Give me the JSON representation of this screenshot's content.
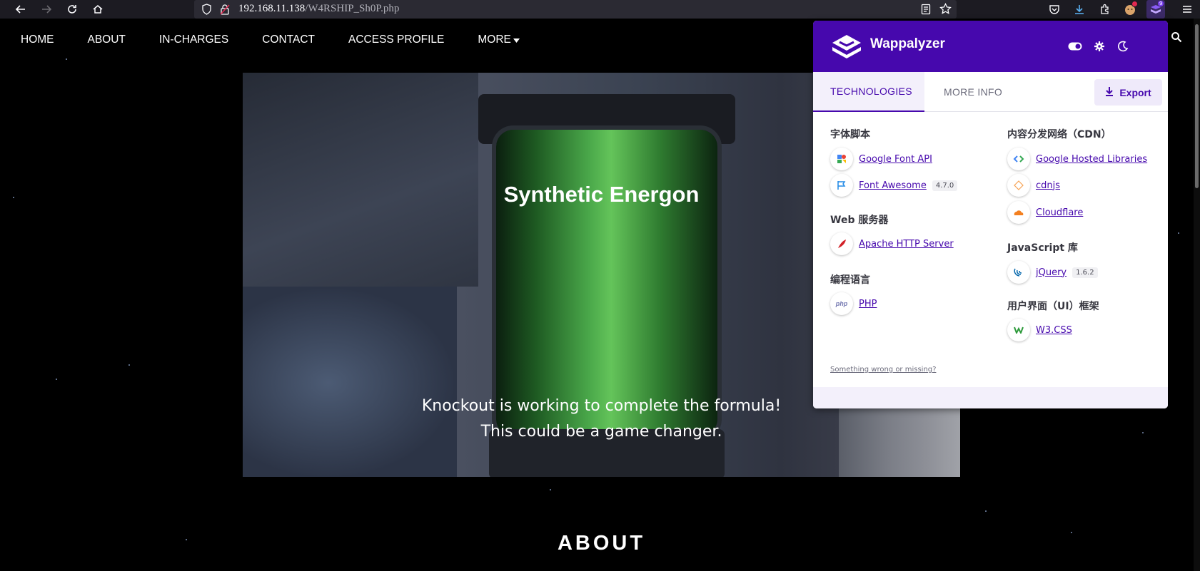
{
  "browser": {
    "url_host": "192.168.11.138",
    "url_path": "/W4RSHIP_Sh0P.php",
    "extension_badge": "9"
  },
  "nav": {
    "items": [
      "HOME",
      "ABOUT",
      "IN-CHARGES",
      "CONTACT",
      "ACCESS PROFILE",
      "MORE"
    ]
  },
  "hero": {
    "title": "Synthetic Energon",
    "subtitle_line1": "Knockout is working to complete the formula!",
    "subtitle_line2": "This could be a game changer."
  },
  "about_heading": "ABOUT",
  "wappalyzer": {
    "brand": "Wappalyzer",
    "tabs": [
      "TECHNOLOGIES",
      "MORE INFO"
    ],
    "export_label": "Export",
    "left_column": [
      {
        "category": "字体脚本",
        "techs": [
          {
            "name": "Google Font API",
            "version": "",
            "icon": "google-font-icon"
          },
          {
            "name": "Font Awesome",
            "version": "4.7.0",
            "icon": "flag-icon"
          }
        ]
      },
      {
        "category": "Web 服务器",
        "techs": [
          {
            "name": "Apache HTTP Server",
            "version": "",
            "icon": "apache-feather-icon"
          }
        ]
      },
      {
        "category": "编程语言",
        "techs": [
          {
            "name": "PHP",
            "version": "",
            "icon": "php-icon"
          }
        ]
      }
    ],
    "right_column": [
      {
        "category": "内容分发网络（CDN）",
        "techs": [
          {
            "name": "Google Hosted Libraries",
            "version": "",
            "icon": "code-brackets-icon"
          },
          {
            "name": "cdnjs",
            "version": "",
            "icon": "cdnjs-icon"
          },
          {
            "name": "Cloudflare",
            "version": "",
            "icon": "cloud-icon"
          }
        ]
      },
      {
        "category": "JavaScript 库",
        "techs": [
          {
            "name": "jQuery",
            "version": "1.6.2",
            "icon": "jquery-icon"
          }
        ]
      },
      {
        "category": "用户界面（UI）框架",
        "techs": [
          {
            "name": "W3.CSS",
            "version": "",
            "icon": "w3css-icon"
          }
        ]
      }
    ],
    "wrong_link": "Something wrong or missing?",
    "accent_color": "#4608ad"
  }
}
